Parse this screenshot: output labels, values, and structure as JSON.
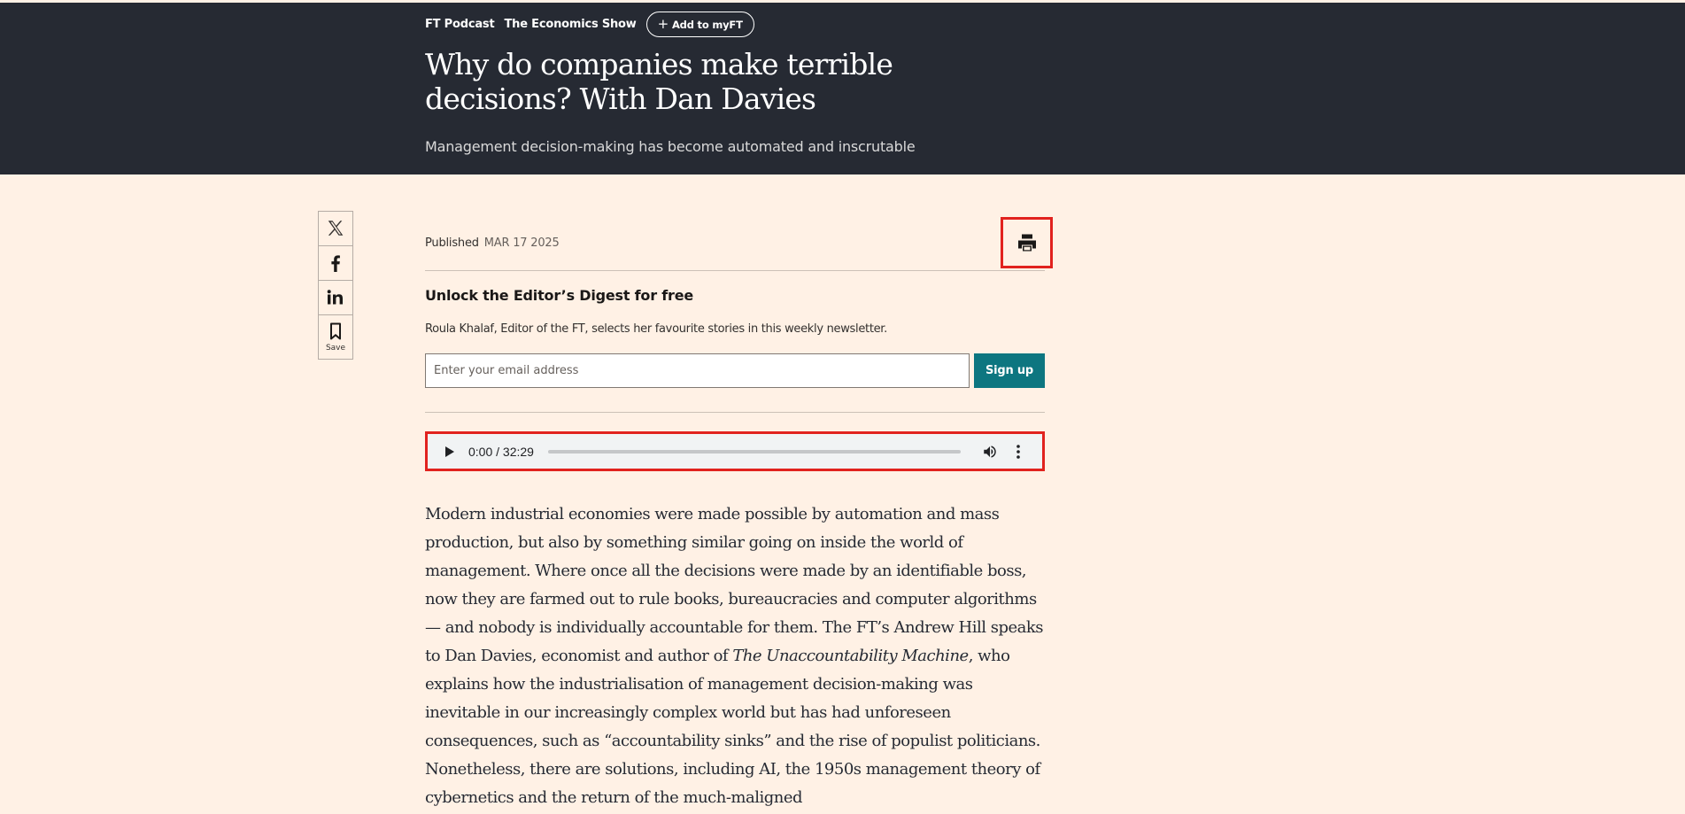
{
  "header": {
    "nav": {
      "podcast_label": "FT Podcast",
      "show_label": "The Economics Show",
      "myft_label": "Add to myFT"
    },
    "headline": "Why do companies make terrible decisions? With Dan Davies",
    "standfirst": "Management decision-making has become automated and inscrutable"
  },
  "share_bar": {
    "items": [
      "x-icon",
      "facebook-icon",
      "linkedin-icon",
      "bookmark-icon"
    ],
    "save_label": "Save"
  },
  "meta": {
    "published_label": "Published",
    "published_date": "MAR 17 2025"
  },
  "newsletter": {
    "title": "Unlock the Editor’s Digest for free",
    "description": "Roula Khalaf, Editor of the FT, selects her favourite stories in this weekly newsletter.",
    "email_placeholder": "Enter your email address",
    "signup_label": "Sign up"
  },
  "audio": {
    "time_display": "0:00 / 32:29",
    "progress_fraction": 0
  },
  "article": {
    "body_before": "Modern industrial economies were made possible by automation and mass production, but also by something similar going on inside the world of management. Where once all the decisions were made by an identifiable boss, now they are farmed out to rule books, bureaucracies and computer algorithms — and nobody is individually accountable for them. The FT’s Andrew Hill speaks to Dan Davies, economist and author of ",
    "book_title": "The Unaccountability Machine",
    "body_after": ", who explains how the industrialisation of management decision-making was inevitable in our increasingly complex world but has had unforeseen consequences, such as “accountability sinks” and the rise of populist politicians. Nonetheless, there are solutions, including AI, the 1950s management theory of cybernetics and the return of the much-maligned"
  },
  "colors": {
    "page_background": "#fff1e5",
    "header_background": "#262a33",
    "signup_button": "#0d7680",
    "highlight_border": "#e1221e"
  }
}
